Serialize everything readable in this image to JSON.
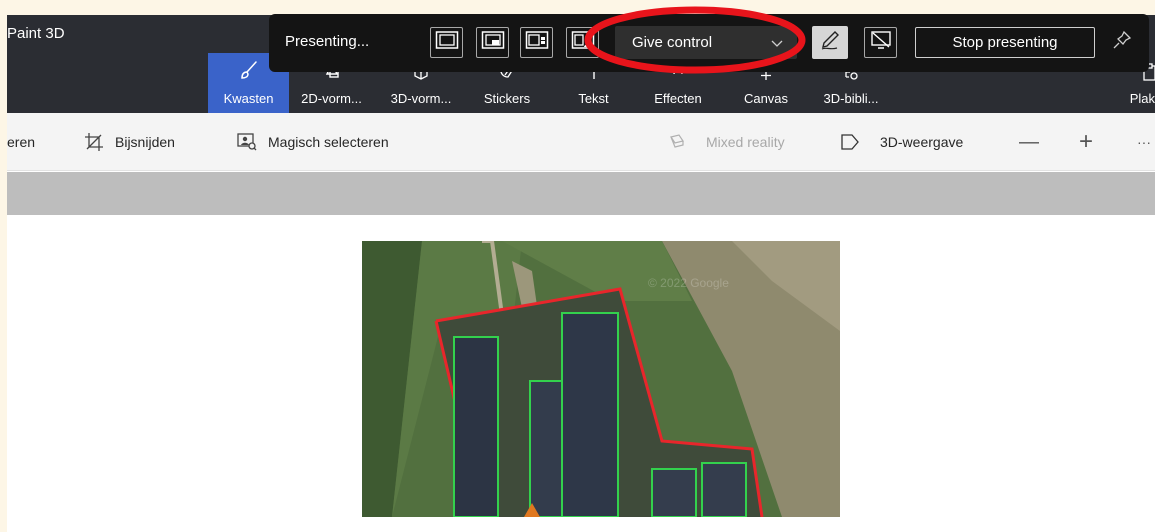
{
  "app": {
    "title": "Paint 3D"
  },
  "ribbon": {
    "tabs": [
      {
        "id": "brushes",
        "label": "Kwasten",
        "icon": "brush-icon",
        "active": true
      },
      {
        "id": "shapes2d",
        "label": "2D-vorm...",
        "icon": "shapes-2d-icon"
      },
      {
        "id": "shapes3d",
        "label": "3D-vorm...",
        "icon": "shapes-3d-icon"
      },
      {
        "id": "stickers",
        "label": "Stickers",
        "icon": "sticker-icon"
      },
      {
        "id": "text",
        "label": "Tekst",
        "icon": "text-icon"
      },
      {
        "id": "effects",
        "label": "Effecten",
        "icon": "effects-icon"
      },
      {
        "id": "canvas",
        "label": "Canvas",
        "icon": "canvas-icon"
      },
      {
        "id": "library3d",
        "label": "3D-bibli...",
        "icon": "library-3d-icon"
      },
      {
        "id": "paste",
        "label": "Plak",
        "icon": "paste-icon"
      }
    ]
  },
  "toolbar": {
    "select_label": "eren",
    "crop_label": "Bijsnijden",
    "magic_select_label": "Magisch selecteren",
    "mixed_reality_label": "Mixed reality",
    "view3d_label": "3D-weergave",
    "zoom_out_label": "—",
    "zoom_in_label": "+",
    "more_label": "···"
  },
  "canvas": {
    "watermark": "© 2022 Google"
  },
  "presenting": {
    "status": "Presenting...",
    "layouts": [
      "content-only-icon",
      "presenter-overlay-icon",
      "side-by-side-icon",
      "reporter-icon"
    ],
    "give_control_label": "Give control",
    "stop_label": "Stop presenting"
  },
  "colors": {
    "ribbon": "#2b2d33",
    "active_tab": "#3a63c9",
    "annotation_ring": "#e8141b",
    "parcel_outline": "#e8262b",
    "building_outline": "#33d14d"
  }
}
